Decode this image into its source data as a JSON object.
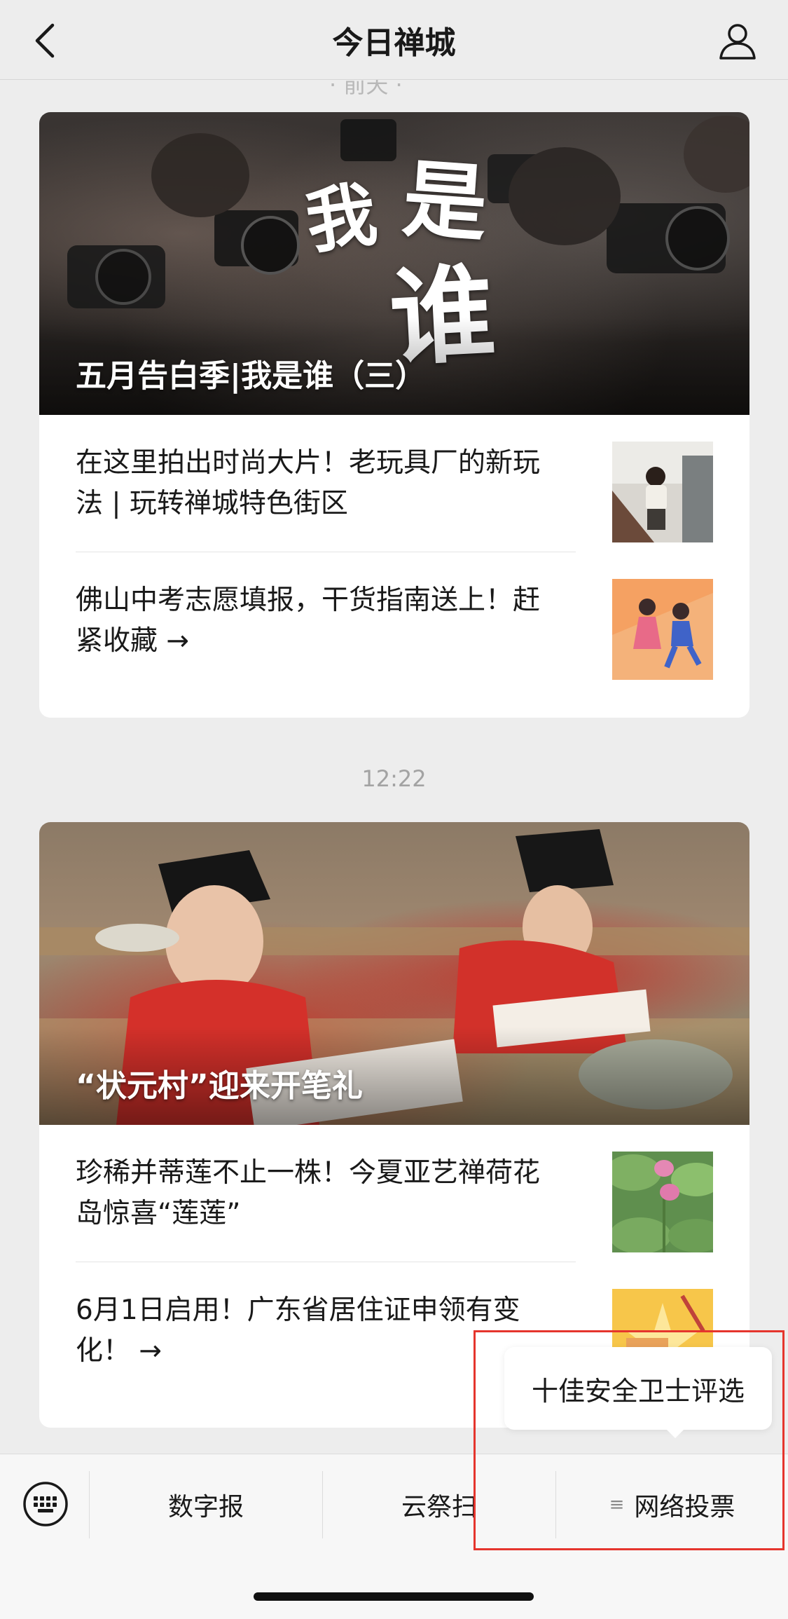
{
  "header": {
    "title": "今日禅城"
  },
  "peek": {
    "text": "· 前天 ·"
  },
  "cards": [
    {
      "hero_title": "五月告白季|我是谁（三）",
      "hero_calligraphy": [
        "我",
        "是",
        "谁"
      ],
      "items": [
        {
          "text": "在这里拍出时尚大片！老玩具厂的新玩法 | 玩转禅城特色街区"
        },
        {
          "text": "佛山中考志愿填报，干货指南送上！赶紧收藏 →"
        }
      ]
    },
    {
      "hero_title": "“状元村”迎来开笔礼",
      "items": [
        {
          "text": "珍稀并蒂莲不止一株！今夏亚艺禅荷花岛惊喜“莲莲”"
        },
        {
          "text": "6月1日启用！广东省居住证申领有变化！ →"
        }
      ]
    }
  ],
  "timestamp": "12:22",
  "menu": {
    "items": [
      {
        "label": "数字报"
      },
      {
        "label": "云祭扫"
      },
      {
        "label": "网络投票",
        "prefix_icon": "≡"
      }
    ]
  },
  "popup": {
    "label": "十佳安全卫士评选"
  },
  "colors": {
    "highlight": "#e5352d",
    "background": "#ededed",
    "card": "#ffffff"
  }
}
